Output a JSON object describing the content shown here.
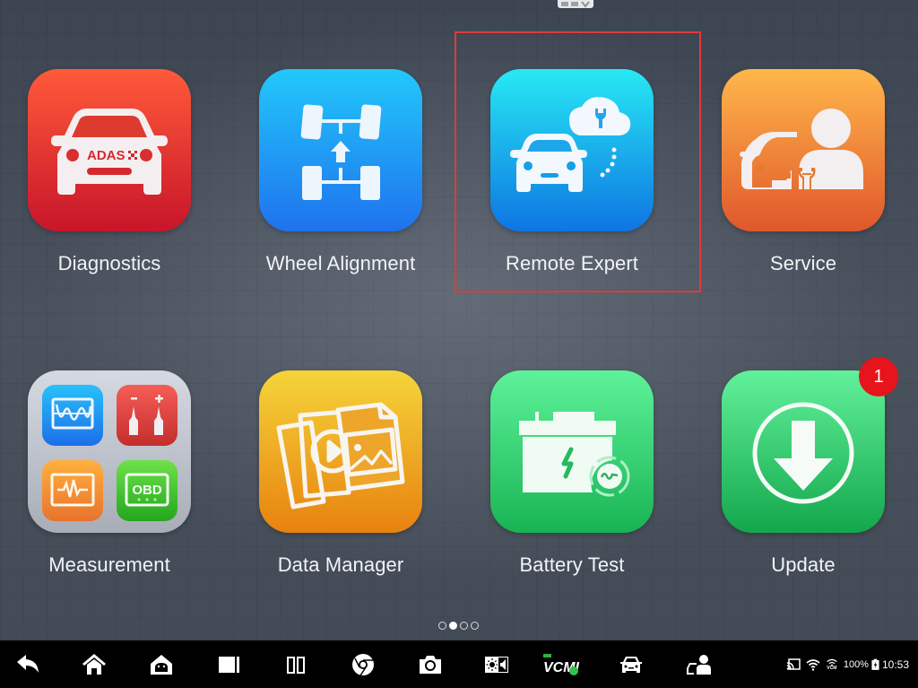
{
  "colors": {
    "selection_frame": "#e03a3a",
    "badge": "#e8141b",
    "navbar": "#000000",
    "label_text": "#f2f3f5"
  },
  "apps": [
    {
      "label": "Diagnostics",
      "icon": "car-adas-icon",
      "gradient": [
        "#ff5a3a",
        "#c8152a"
      ],
      "badge_text": "ADAS"
    },
    {
      "label": "Wheel Alignment",
      "icon": "wheel-alignment-icon",
      "gradient": [
        "#22c8fb",
        "#1f72ee"
      ]
    },
    {
      "label": "Remote Expert",
      "icon": "remote-expert-icon",
      "gradient": [
        "#27e9f4",
        "#0e75e2"
      ],
      "selected": true
    },
    {
      "label": "Service",
      "icon": "service-technician-icon",
      "gradient": [
        "#ffb74a",
        "#e0572c"
      ]
    },
    {
      "label": "Measurement",
      "icon": "measurement-icon",
      "gradient": [
        "#d5d9e1",
        "#a8adb8"
      ],
      "sub_icons": [
        {
          "name": "oscilloscope-icon",
          "gradient": [
            "#29c0fb",
            "#1c6fe9"
          ]
        },
        {
          "name": "multimeter-probes-icon",
          "gradient": [
            "#f55d57",
            "#c42e2c"
          ]
        },
        {
          "name": "waveform-icon",
          "gradient": [
            "#ffb03e",
            "#e8732c"
          ]
        },
        {
          "name": "obd-icon",
          "gradient": [
            "#6ee14a",
            "#23a71e"
          ],
          "text": "OBD"
        }
      ]
    },
    {
      "label": "Data Manager",
      "icon": "data-manager-icon",
      "gradient": [
        "#f5d43a",
        "#e8820f"
      ]
    },
    {
      "label": "Battery Test",
      "icon": "battery-test-icon",
      "gradient": [
        "#5ef29a",
        "#18b453"
      ]
    },
    {
      "label": "Update",
      "icon": "update-download-icon",
      "gradient": [
        "#62f19b",
        "#13a74c"
      ],
      "badge_count": "1"
    }
  ],
  "pager": {
    "pages": 4,
    "active_index": 1
  },
  "navbar": {
    "buttons": [
      {
        "name": "back-icon"
      },
      {
        "name": "home-icon"
      },
      {
        "name": "android-home-icon"
      },
      {
        "name": "recent-apps-icon"
      },
      {
        "name": "split-screen-icon"
      },
      {
        "name": "chrome-browser-icon"
      },
      {
        "name": "camera-icon"
      },
      {
        "name": "brightness-volume-icon"
      },
      {
        "name": "vcmi-icon",
        "text": "VCMI"
      },
      {
        "name": "car-icon"
      },
      {
        "name": "service-icon"
      }
    ],
    "status": {
      "battery_percent": "100%",
      "time": "10:53",
      "vcm_label": "VCM"
    }
  }
}
